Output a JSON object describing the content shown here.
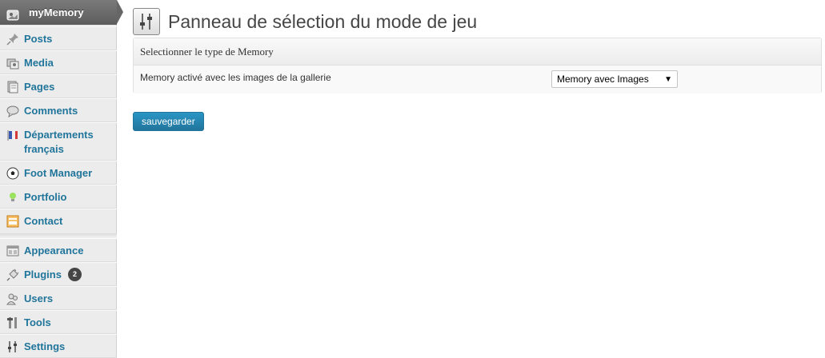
{
  "sidebar": {
    "active": {
      "label": "myMemory",
      "icon": "memory-icon"
    },
    "items": [
      {
        "label": "Posts",
        "icon": "pin-icon"
      },
      {
        "label": "Media",
        "icon": "media-icon"
      },
      {
        "label": "Pages",
        "icon": "pages-icon"
      },
      {
        "label": "Comments",
        "icon": "comment-icon"
      },
      {
        "label": "Départements français",
        "icon": "flag-icon"
      },
      {
        "label": "Foot Manager",
        "icon": "football-icon"
      },
      {
        "label": "Portfolio",
        "icon": "lightbulb-icon"
      },
      {
        "label": "Contact",
        "icon": "contact-form-icon"
      },
      {
        "label": "Appearance",
        "icon": "appearance-icon"
      },
      {
        "label": "Plugins",
        "icon": "plug-icon",
        "badge": "2"
      },
      {
        "label": "Users",
        "icon": "users-icon"
      },
      {
        "label": "Tools",
        "icon": "tools-icon"
      },
      {
        "label": "Settings",
        "icon": "settings-icon"
      }
    ]
  },
  "main": {
    "title": "Panneau de sélection du mode de jeu",
    "title_icon": "sliders-icon",
    "panel": {
      "heading": "Selectionner le type de Memory",
      "row_label": "Memory activé avec les images de la gallerie",
      "select_value": "Memory avec Images"
    },
    "save_label": "sauvegarder"
  },
  "colors": {
    "link": "#21759b",
    "sidebar_bg": "#ececec",
    "active_bg": "#6d6d6d",
    "button": "#2a95c5"
  }
}
